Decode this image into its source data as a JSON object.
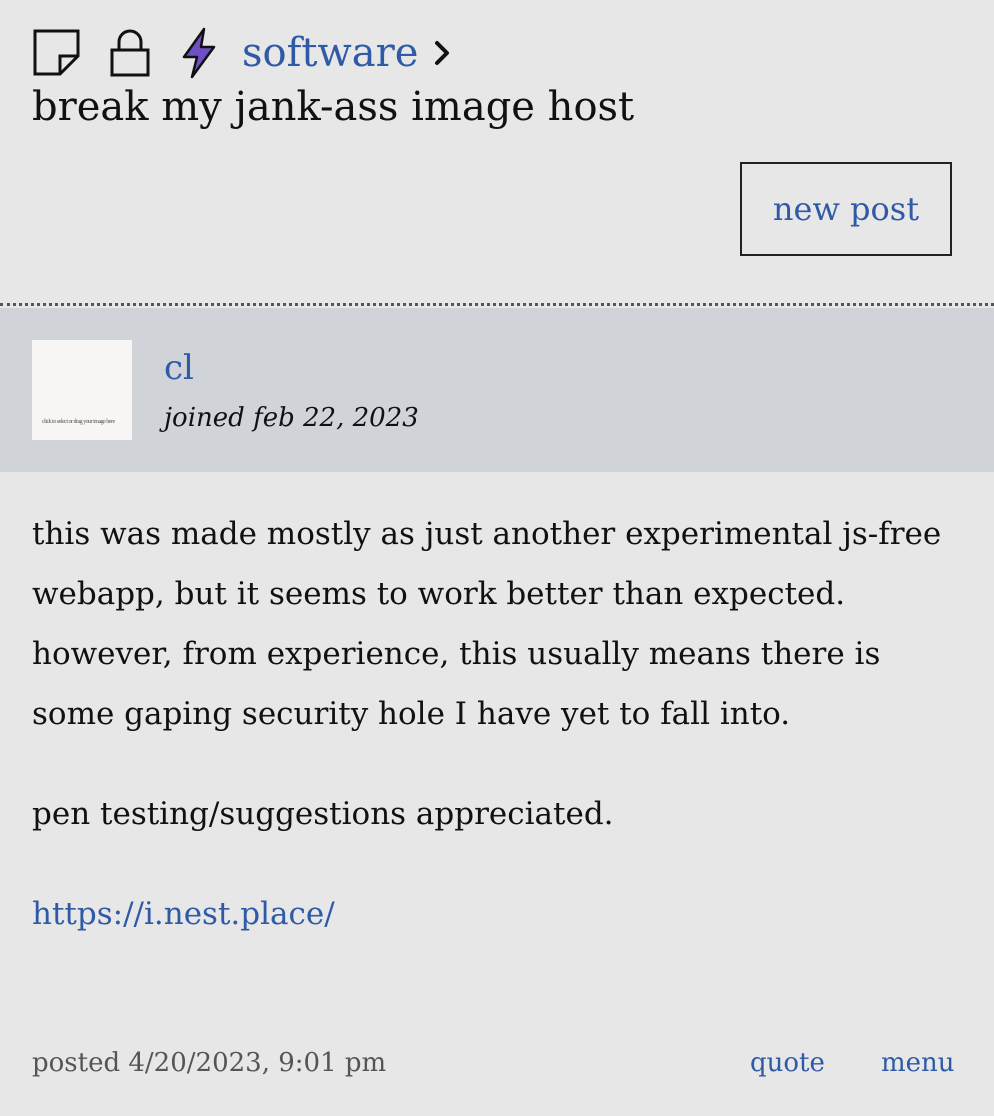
{
  "breadcrumb": {
    "icons": [
      "sticky-icon",
      "lock-icon",
      "lightning-icon"
    ],
    "category": "software"
  },
  "thread": {
    "title": "break my jank-ass image host",
    "new_post_label": "new post"
  },
  "author": {
    "name": "cl",
    "joined": "joined feb 22, 2023",
    "avatar_text": "click to select or drag your image here"
  },
  "post": {
    "paragraphs": [
      "this was made mostly as just another experimental js-free webapp, but it seems to work better than expected. however, from experience, this usually means there is some gaping security hole I have yet to fall into.",
      "pen testing/suggestions appreciated."
    ],
    "link": "https://i.nest.place/",
    "posted": "posted 4/20/2023, 9:01 pm",
    "quote_label": "quote",
    "menu_label": "menu"
  },
  "colors": {
    "background": "#e7e7e8",
    "author_bar": "#d0d3d8",
    "link": "#2f5aa5",
    "bolt": "#6f4fc4"
  }
}
